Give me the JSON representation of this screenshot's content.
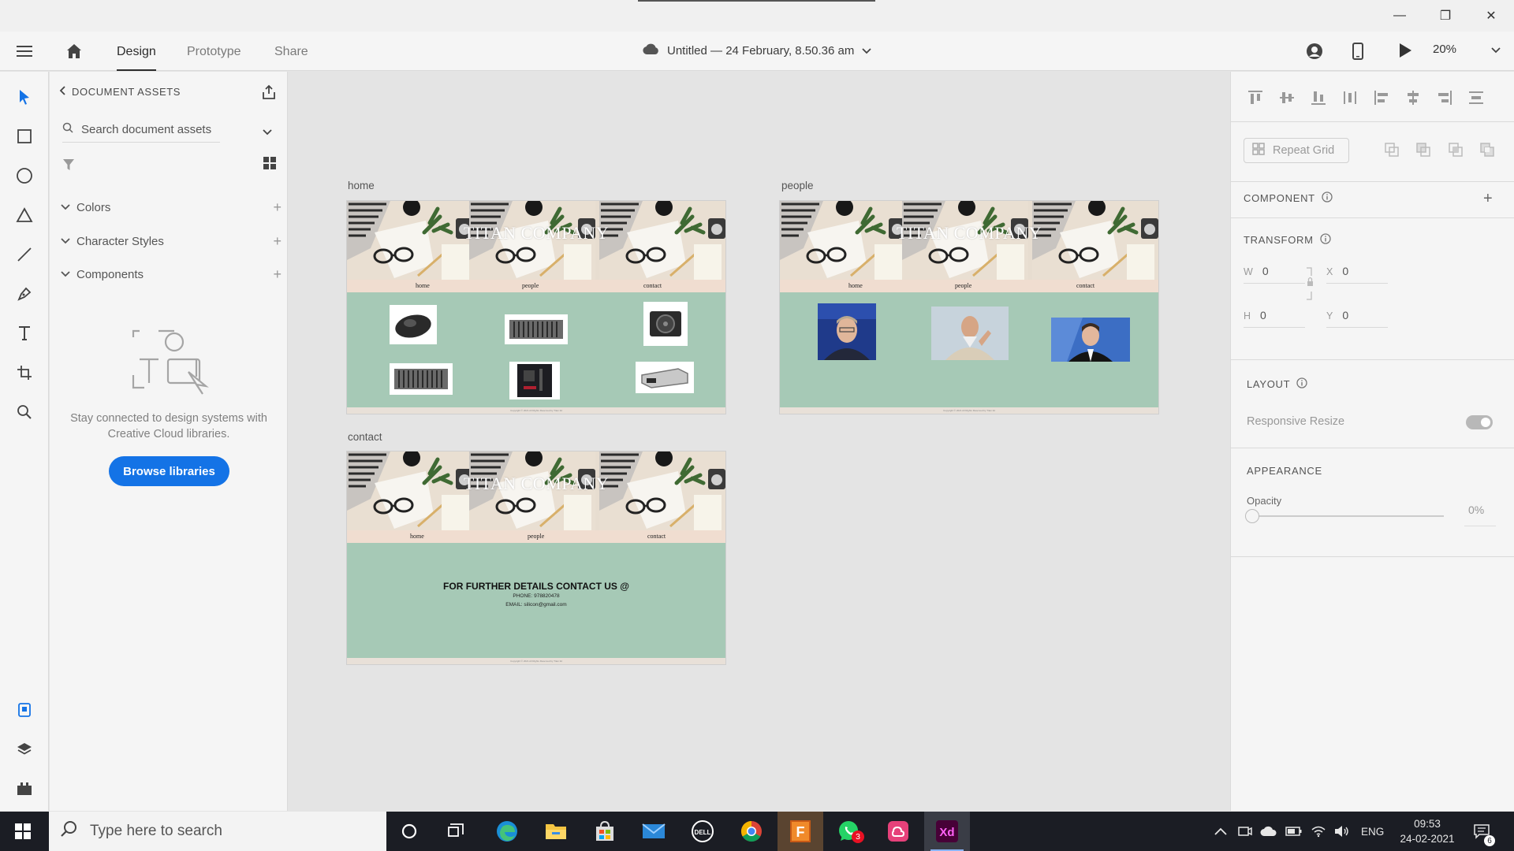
{
  "window": {
    "minimize": "—",
    "maximize": "❐",
    "close": "✕"
  },
  "toolbar": {
    "tabs": [
      {
        "label": "Design",
        "active": true
      },
      {
        "label": "Prototype",
        "active": false
      },
      {
        "label": "Share",
        "active": false
      }
    ],
    "doc_title": "Untitled — 24 February, 8.50.36 am",
    "zoom": "20%"
  },
  "assets_panel": {
    "header": "DOCUMENT ASSETS",
    "search_placeholder": "Search document assets",
    "sections": [
      {
        "label": "Colors"
      },
      {
        "label": "Character Styles"
      },
      {
        "label": "Components"
      }
    ],
    "cc_text": "Stay connected to design systems with Creative Cloud libraries.",
    "browse_button": "Browse libraries"
  },
  "artboards": {
    "home_label": "home",
    "people_label": "people",
    "contact_label": "contact",
    "site_title": "TITAN COMPANY",
    "nav": [
      "home",
      "people",
      "contact"
    ],
    "footer": "Copyright © 2021 All Rights Reserved by Titan ltd",
    "contact_heading": "FOR FURTHER DETAILS CONTACT US @",
    "contact_phone": "PHONE: 978820478",
    "contact_email": "EMAIL: silicon@gmail.com"
  },
  "properties": {
    "repeat_grid": "Repeat Grid",
    "component": "COMPONENT",
    "transform": "TRANSFORM",
    "w_label": "W",
    "w_value": "0",
    "x_label": "X",
    "x_value": "0",
    "h_label": "H",
    "h_value": "0",
    "y_label": "Y",
    "y_value": "0",
    "layout": "LAYOUT",
    "responsive_resize": "Responsive Resize",
    "responsive_resize_on": true,
    "appearance": "APPEARANCE",
    "opacity_label": "Opacity",
    "opacity_value": "0%"
  },
  "taskbar": {
    "search_placeholder": "Type here to search",
    "whatsapp_badge": "3",
    "lang": "ENG",
    "time": "09:53",
    "date": "24-02-2021",
    "notification_count": "6"
  },
  "colors": {
    "accent": "#1473e6",
    "artboard_bg": "#a6c9b6",
    "taskbar": "#1b1d24",
    "xd_brand": "#ff61f6"
  }
}
